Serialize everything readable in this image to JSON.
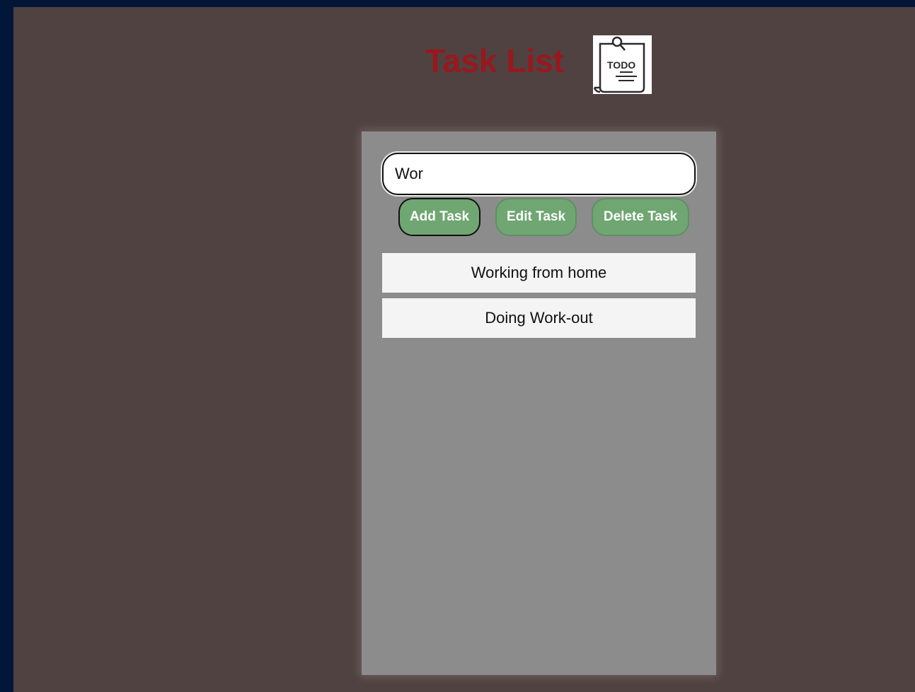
{
  "header": {
    "title": "Task List",
    "logo_icon": "todo-note-icon",
    "logo_text": "TODO"
  },
  "input": {
    "value": "Wor",
    "placeholder": ""
  },
  "buttons": {
    "add": "Add Task",
    "edit": "Edit Task",
    "delete": "Delete Task"
  },
  "tasks": [
    "Working from home",
    "Doing Work-out"
  ],
  "colors": {
    "outer_background": "#011638",
    "page_background": "#4f4241",
    "title": "#98181d",
    "panel": "#8c8c8c",
    "button": "#6fa672",
    "task_item": "#f4f4f4"
  }
}
